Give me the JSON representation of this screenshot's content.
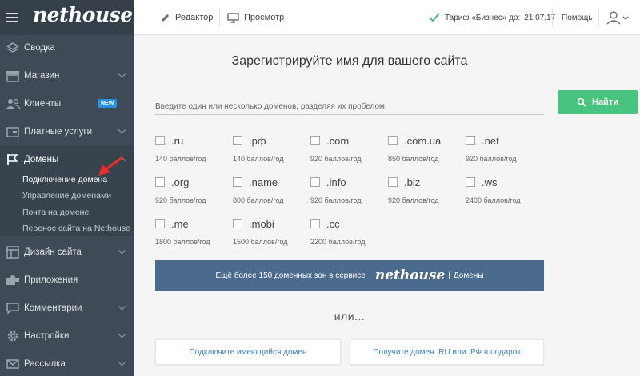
{
  "app": {
    "logo": "nethouse"
  },
  "topbar": {
    "editor": "Редактор",
    "preview": "Просмотр",
    "plan": "Тариф «Бизнес» до:",
    "plan_date": "21.07.17",
    "help": "Помощь"
  },
  "sidebar": {
    "items": [
      {
        "label": "Сводка",
        "icon": "layers-icon"
      },
      {
        "label": "Магазин",
        "icon": "store-icon"
      },
      {
        "label": "Клиенты",
        "icon": "users-icon",
        "badge": "NEW"
      },
      {
        "label": "Платные услуги",
        "icon": "wallet-icon"
      },
      {
        "label": "Домены",
        "icon": "flag-icon"
      },
      {
        "label": "Дизайн сайта",
        "icon": "layout-icon"
      },
      {
        "label": "Приложения",
        "icon": "puzzle-icon"
      },
      {
        "label": "Комментарии",
        "icon": "comment-icon"
      },
      {
        "label": "Настройки",
        "icon": "gear-icon"
      },
      {
        "label": "Рассылка",
        "icon": "mail-icon"
      }
    ],
    "domain_sub": [
      "Подключение домена",
      "Управление доменами",
      "Почта на домене",
      "Перенос сайта на Nethouse"
    ]
  },
  "main": {
    "title": "Зарегистрируйте имя для вашего сайта",
    "search_placeholder": "Введите один или несколько доменов, разделяя их пробелом",
    "search_button": "Найти",
    "zones": [
      {
        "name": ".ru",
        "price": "140 баллов/год"
      },
      {
        "name": ".рф",
        "price": "140 баллов/год"
      },
      {
        "name": ".com",
        "price": "920 баллов/год"
      },
      {
        "name": ".com.ua",
        "price": "850 баллов/год"
      },
      {
        "name": ".net",
        "price": "920 баллов/год"
      },
      {
        "name": ".org",
        "price": "920 баллов/год"
      },
      {
        "name": ".name",
        "price": "800 баллов/год"
      },
      {
        "name": ".info",
        "price": "920 баллов/год"
      },
      {
        "name": ".biz",
        "price": "920 баллов/год"
      },
      {
        "name": ".ws",
        "price": "2400 баллов/год"
      },
      {
        "name": ".me",
        "price": "1800 баллов/год"
      },
      {
        "name": ".mobi",
        "price": "1500 баллов/год"
      },
      {
        "name": ".cc",
        "price": "2200 баллов/год"
      }
    ],
    "banner": {
      "text": "Ещё более 150 доменных зон в сервисе",
      "logo": "nethouse",
      "sep": "|",
      "link": "Домены"
    },
    "or": "или...",
    "connect_button": "Подключите имеющийся домен",
    "gift_button": "Получите домен .RU или .РФ в подарок"
  },
  "colors": {
    "sidebar": "#3e4a55",
    "accent_green": "#48c47f",
    "banner": "#4a6b8e",
    "link": "#3d7fc6",
    "arrow": "#e8302a"
  }
}
